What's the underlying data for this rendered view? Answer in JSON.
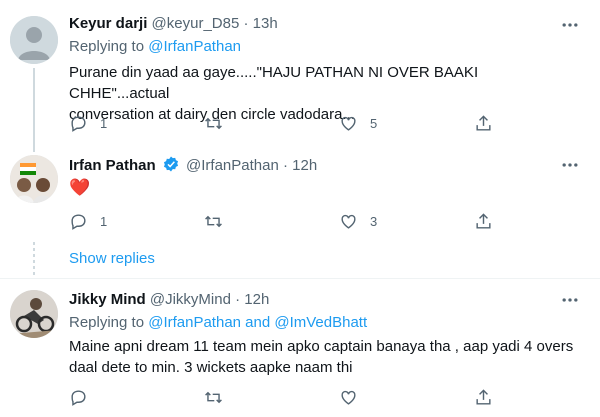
{
  "tweets": [
    {
      "name": "Keyur darji",
      "handle": "@keyur_D85",
      "time": "13h",
      "replying_prefix": "Replying to",
      "replying_to": "@IrfanPathan",
      "text_line1": "Purane din yaad aa gaye.....\"HAJU PATHAN NI OVER BAAKI CHHE\"...actual",
      "text_line2": "conversation at dairy den circle vadodara...",
      "replies": "1",
      "retweets": "",
      "likes": "5"
    },
    {
      "name": "Irfan Pathan",
      "handle": "@IrfanPathan",
      "time": "12h",
      "text": "❤️",
      "verified": true,
      "replies": "1",
      "retweets": "",
      "likes": "3"
    },
    {
      "name": "Jikky Mind",
      "handle": "@JikkyMind",
      "time": "12h",
      "replying_prefix": "Replying to",
      "replying_to": "@IrfanPathan and @ImVedBhatt",
      "text_line1": "Maine apni dream 11 team mein apko captain banaya tha , aap yadi 4 overs",
      "text_line2": "daal dete to min. 3 wickets aapke naam thi"
    }
  ],
  "show_replies": "Show replies",
  "separator": "·",
  "colors": {
    "accent": "#1d9bf0",
    "secondary_text": "#536471",
    "heart": "#f91880"
  },
  "icons": [
    "more-icon",
    "reply-icon",
    "retweet-icon",
    "like-icon",
    "share-icon",
    "verified-icon"
  ]
}
